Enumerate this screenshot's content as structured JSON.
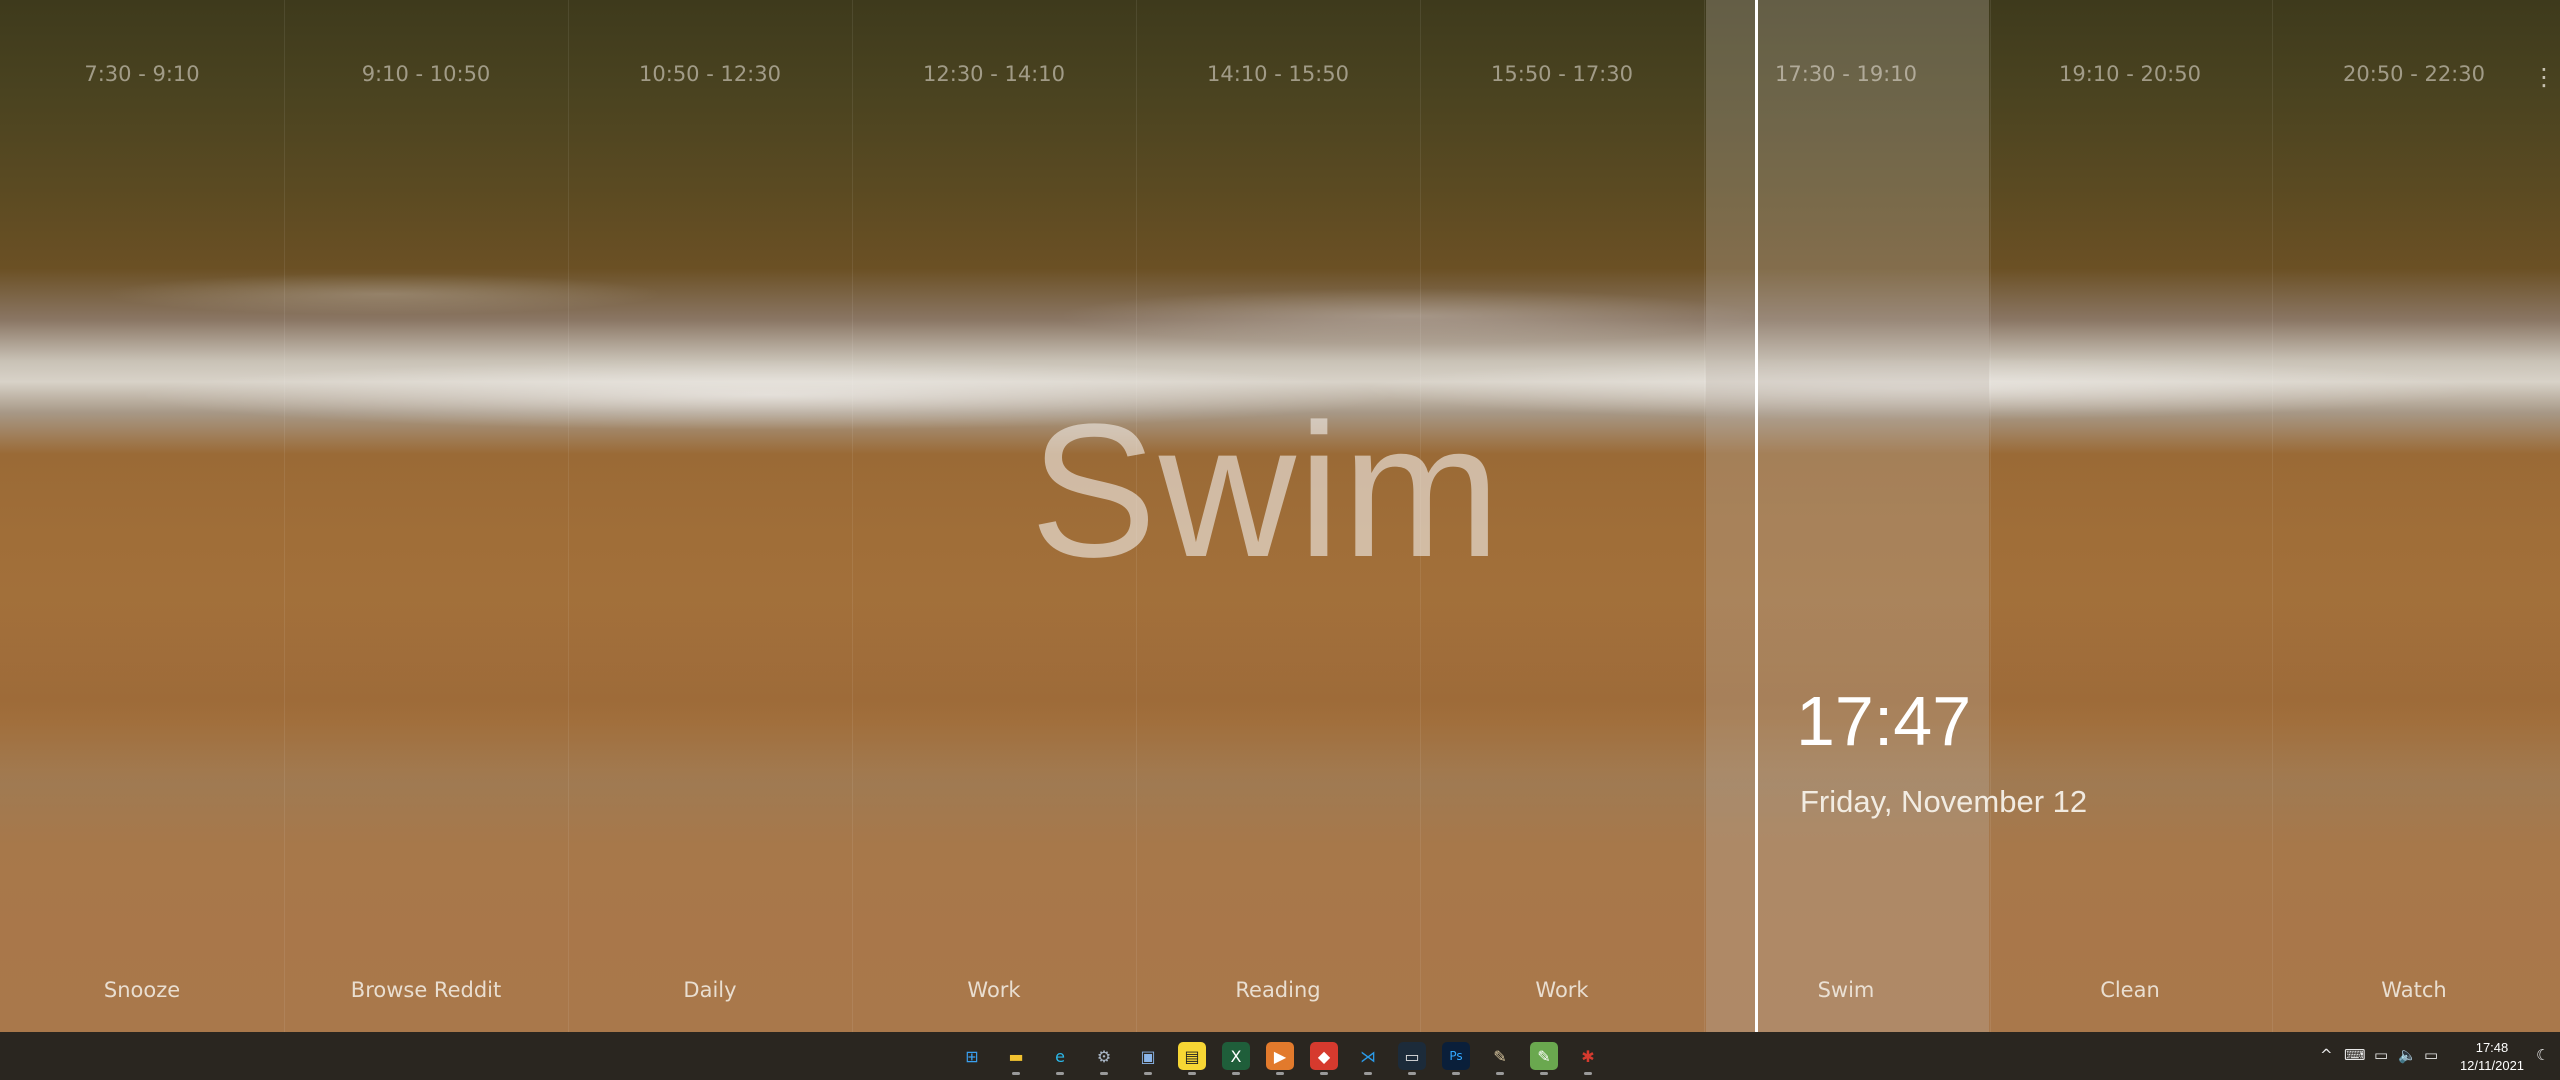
{
  "schedule": {
    "slots": [
      {
        "time": "7:30  - 9:10",
        "label": "Snooze"
      },
      {
        "time": "9:10 - 10:50",
        "label": "Browse Reddit"
      },
      {
        "time": "10:50 - 12:30",
        "label": "Daily"
      },
      {
        "time": "12:30 - 14:10",
        "label": "Work"
      },
      {
        "time": "14:10 - 15:50",
        "label": "Reading"
      },
      {
        "time": "15:50 - 17:30",
        "label": "Work"
      },
      {
        "time": "17:30 - 19:10",
        "label": "Swim"
      },
      {
        "time": "19:10 - 20:50",
        "label": "Clean"
      },
      {
        "time": "20:50 - 22:30",
        "label": "Watch"
      }
    ],
    "current_activity": "Swim",
    "clock": "17:47",
    "date": "Friday, November 12",
    "more_icon": "⋮"
  },
  "taskbar": {
    "icons": [
      {
        "name": "start-icon",
        "glyph": "⊞",
        "color": "#3aa0f0",
        "bg": "transparent"
      },
      {
        "name": "file-explorer-icon",
        "glyph": "▬",
        "color": "#f2c230",
        "bg": "transparent"
      },
      {
        "name": "edge-icon",
        "glyph": "e",
        "color": "#2bb7e8",
        "bg": "transparent"
      },
      {
        "name": "settings-icon",
        "glyph": "⚙",
        "color": "#a9b6c6",
        "bg": "transparent"
      },
      {
        "name": "photos-icon",
        "glyph": "▣",
        "color": "#8ab4e8",
        "bg": "transparent"
      },
      {
        "name": "sticky-notes-icon",
        "glyph": "▤",
        "color": "#222222",
        "bg": "#f7d634"
      },
      {
        "name": "excel-like-icon",
        "glyph": "X",
        "color": "#ffffff",
        "bg": "#1f5e3a"
      },
      {
        "name": "media-player-icon",
        "glyph": "▶",
        "color": "#ffffff",
        "bg": "#e27a2c"
      },
      {
        "name": "app-red-icon",
        "glyph": "◆",
        "color": "#ffffff",
        "bg": "#d63a2e"
      },
      {
        "name": "vscode-icon",
        "glyph": "⋊",
        "color": "#2b9be8",
        "bg": "transparent"
      },
      {
        "name": "terminal-icon",
        "glyph": "▭",
        "color": "#e0e0e0",
        "bg": "#1c2b3a"
      },
      {
        "name": "photoshop-icon",
        "glyph": "Ps",
        "color": "#31a8ff",
        "bg": "#0a1f3a"
      },
      {
        "name": "paint-brush-icon",
        "glyph": "✎",
        "color": "#d9c7a0",
        "bg": "transparent"
      },
      {
        "name": "notepad-icon",
        "glyph": "✎",
        "color": "#ffffff",
        "bg": "#6aa84f"
      },
      {
        "name": "bug-app-icon",
        "glyph": "✱",
        "color": "#d63a2e",
        "bg": "transparent"
      }
    ],
    "tray": {
      "chevron": "^",
      "keyboard_icon": "⌨",
      "network_icon": "▭",
      "volume_icon": "🔈",
      "battery_icon": "▭",
      "time": "17:48",
      "date": "12/11/2021",
      "notification_icon": "☾"
    }
  }
}
